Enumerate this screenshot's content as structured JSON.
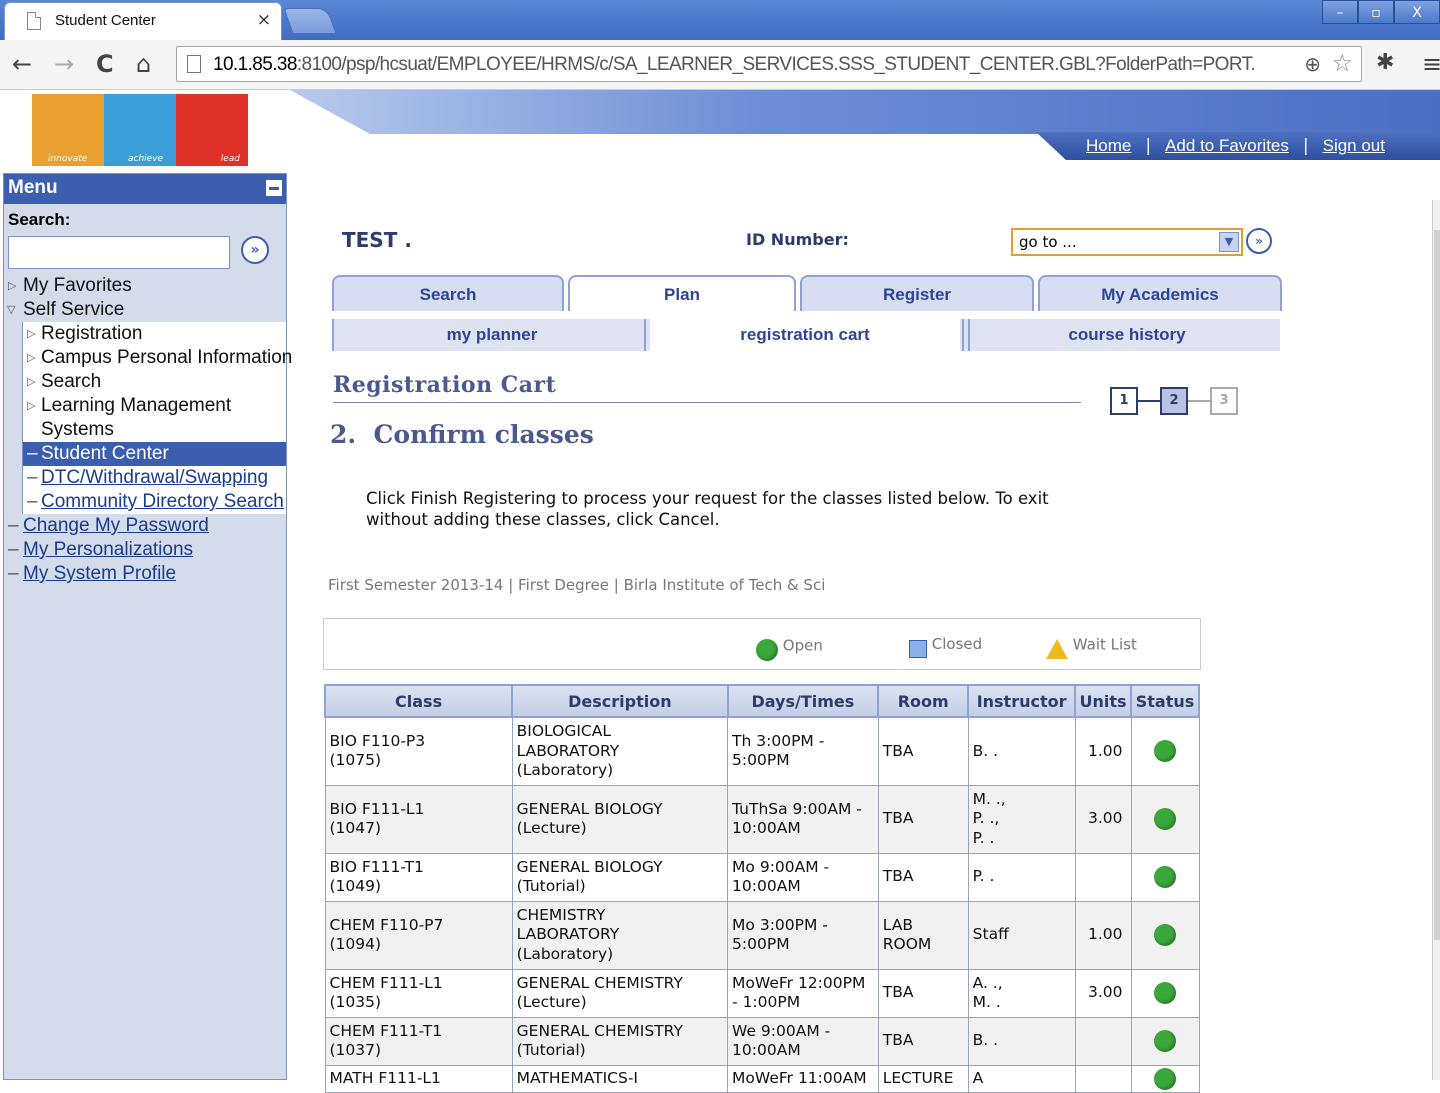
{
  "browser": {
    "tab_title": "Student Center",
    "tab_close": "×",
    "url_host": "10.1.85.38",
    "url_rest": ":8100/psp/hcsuat/EMPLOYEE/HRMS/c/SA_LEARNER_SERVICES.SSS_STUDENT_CENTER.GBL?FolderPath=PORT.",
    "back": "←",
    "forward": "→",
    "reload": "C",
    "home": "⌂",
    "win_min": "–",
    "win_restore": "▫",
    "win_close": "X"
  },
  "header": {
    "logo_words": [
      "innovate",
      "achieve",
      "lead"
    ],
    "links": [
      "Home",
      "Add to Favorites",
      "Sign out"
    ],
    "sep": "|"
  },
  "menu": {
    "title": "Menu",
    "search_label": "Search:",
    "go": "»",
    "items": {
      "favorites": "My Favorites",
      "self_service": "Self Service",
      "registration": "Registration",
      "campus_info": "Campus Personal Information",
      "search": "Search",
      "lms_1": "Learning Management",
      "lms_2": "Systems",
      "student_center": "Student Center",
      "dtc": "DTC/Withdrawal/Swapping",
      "community": "Community Directory Search",
      "change_password": "Change My Password",
      "personalizations": "My Personalizations",
      "system_profile": "My System Profile"
    }
  },
  "student": {
    "name": "TEST .",
    "id_label": "ID Number:",
    "goto_value": "go to ...",
    "goto_arrow": "▼",
    "goto_btn": "»"
  },
  "tabs": [
    "Search",
    "Plan",
    "Register",
    "My Academics"
  ],
  "subtabs": [
    "my planner",
    "registration cart",
    "course history"
  ],
  "page": {
    "cart_title": "Registration Cart",
    "steps": [
      "1",
      "2",
      "3"
    ],
    "confirm_title": "2.  Confirm classes",
    "instructions": "Click Finish Registering to process your request for the classes listed below. To exit without adding these classes, click Cancel.",
    "term": "First Semester 2013-14 | First Degree | Birla Institute of Tech & Sci"
  },
  "legend": {
    "open": "Open",
    "closed": "Closed",
    "wait": "Wait List"
  },
  "table": {
    "headers": [
      "Class",
      "Description",
      "Days/Times",
      "Room",
      "Instructor",
      "Units",
      "Status"
    ],
    "rows": [
      {
        "class_1": "BIO F110-P3",
        "class_2": "(1075)",
        "desc": [
          "BIOLOGICAL",
          "LABORATORY",
          "(Laboratory)"
        ],
        "days": [
          "Th 3:00PM -",
          "5:00PM"
        ],
        "room": [
          "TBA"
        ],
        "instr": [
          "B. ."
        ],
        "units": "1.00",
        "status": "open"
      },
      {
        "class_1": "BIO F111-L1",
        "class_2": "(1047)",
        "desc": [
          "GENERAL BIOLOGY",
          "(Lecture)"
        ],
        "days": [
          "TuThSa 9:00AM -",
          "10:00AM"
        ],
        "room": [
          "TBA"
        ],
        "instr": [
          "M. .,",
          "P. .,",
          "P. ."
        ],
        "units": "3.00",
        "status": "open"
      },
      {
        "class_1": "BIO F111-T1",
        "class_2": "(1049)",
        "desc": [
          "GENERAL BIOLOGY",
          "(Tutorial)"
        ],
        "days": [
          "Mo 9:00AM -",
          "10:00AM"
        ],
        "room": [
          "TBA"
        ],
        "instr": [
          "P. ."
        ],
        "units": "",
        "status": "open"
      },
      {
        "class_1": "CHEM F110-P7",
        "class_2": "(1094)",
        "desc": [
          "CHEMISTRY",
          "LABORATORY",
          "(Laboratory)"
        ],
        "days": [
          "Mo 3:00PM -",
          "5:00PM"
        ],
        "room": [
          "LAB",
          "ROOM"
        ],
        "instr": [
          "Staff"
        ],
        "units": "1.00",
        "status": "open"
      },
      {
        "class_1": "CHEM F111-L1",
        "class_2": "(1035)",
        "desc": [
          "GENERAL CHEMISTRY",
          "(Lecture)"
        ],
        "days": [
          "MoWeFr 12:00PM",
          "- 1:00PM"
        ],
        "room": [
          "TBA"
        ],
        "instr": [
          "A. .,",
          "M. ."
        ],
        "units": "3.00",
        "status": "open"
      },
      {
        "class_1": "CHEM F111-T1",
        "class_2": "(1037)",
        "desc": [
          "GENERAL CHEMISTRY",
          "(Tutorial)"
        ],
        "days": [
          "We 9:00AM -",
          "10:00AM"
        ],
        "room": [
          "TBA"
        ],
        "instr": [
          "B. ."
        ],
        "units": "",
        "status": "open"
      },
      {
        "class_1": "MATH F111-L1",
        "class_2": "",
        "desc": [
          "MATHEMATICS-I"
        ],
        "days": [
          "MoWeFr 11:00AM"
        ],
        "room": [
          "LECTURE"
        ],
        "instr": [
          "A"
        ],
        "units": "",
        "status": "open"
      }
    ]
  },
  "colors": {
    "accent": "#3b5fae",
    "open": "#3aa83a",
    "closed": "#8ab0e8",
    "wait": "#f0b820"
  }
}
